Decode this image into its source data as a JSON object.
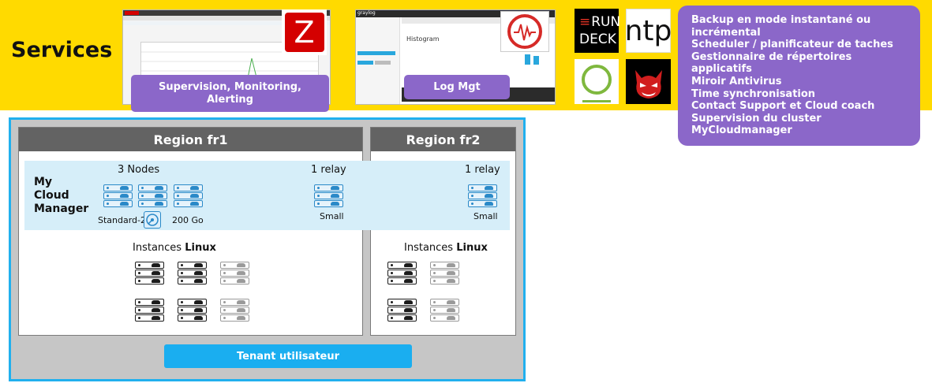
{
  "services": {
    "title": "Services",
    "monitoring_label": "Supervision, Monitoring,\nAlerting",
    "log_label": "Log Mgt",
    "rundeck": {
      "line1": "RUN",
      "line2": "DECK"
    },
    "ntp": "ntp",
    "zabbix_letter": "Z",
    "graylog_brand": "graylog",
    "histogram_title": "Histogram",
    "list": [
      "Backup en mode instantané ou incrémental",
      "Scheduler / planificateur de taches",
      "Gestionnaire de répertoires applicatifs",
      "Miroir Antivirus",
      "Time synchronisation",
      "Contact Support et Cloud coach",
      "Supervision du cluster",
      "MyCloudmanager"
    ]
  },
  "tenant": {
    "button": "Tenant utilisateur",
    "region1": {
      "title": "Region fr1",
      "nodes": "3 Nodes",
      "relay": "1 relay",
      "relay_size": "Small",
      "manager_label": "My\nCloud\nManager",
      "flavor": "Standard-2",
      "storage": "200 Go",
      "instances_prefix": "Instances ",
      "instances_os": "Linux"
    },
    "region2": {
      "title": "Region fr2",
      "relay": "1 relay",
      "relay_size": "Small",
      "instances_prefix": "Instances ",
      "instances_os": "Linux"
    }
  },
  "colors": {
    "band": "#ffda00",
    "purple": "#8b67c9",
    "tenant_border": "#21b0ee",
    "region_header": "#636363",
    "cluster_band": "#d6eef9",
    "server_blue": "#2a89c8"
  },
  "icons": [
    "zabbix-logo",
    "graylog-alert-icon",
    "rundeck-logo",
    "ntp-logo",
    "antivirus-devil-icon",
    "ring-logo",
    "disk-icon",
    "server-icon"
  ]
}
